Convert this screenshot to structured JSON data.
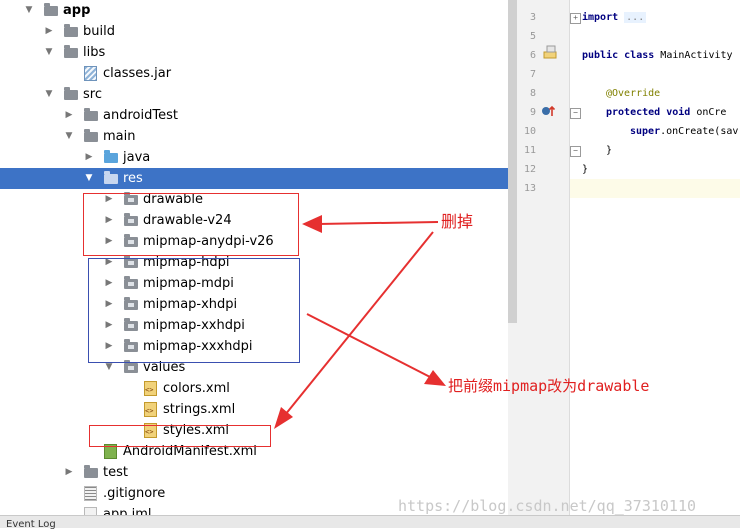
{
  "tree": {
    "rows": [
      {
        "label": "app",
        "indent": 0,
        "arrow": "down",
        "icon": "folder-icon",
        "bold": true
      },
      {
        "label": "build",
        "indent": 1,
        "arrow": "right",
        "icon": "folder-icon"
      },
      {
        "label": "libs",
        "indent": 1,
        "arrow": "down",
        "icon": "folder-icon"
      },
      {
        "label": "classes.jar",
        "indent": 2,
        "arrow": "none",
        "icon": "jar-file-icon"
      },
      {
        "label": "src",
        "indent": 1,
        "arrow": "down",
        "icon": "folder-icon"
      },
      {
        "label": "androidTest",
        "indent": 2,
        "arrow": "right",
        "icon": "folder-icon"
      },
      {
        "label": "main",
        "indent": 2,
        "arrow": "down",
        "icon": "folder-icon"
      },
      {
        "label": "java",
        "indent": 3,
        "arrow": "right",
        "icon": "source-folder-icon"
      },
      {
        "label": "res",
        "indent": 3,
        "arrow": "down",
        "icon": "resource-folder-icon",
        "selected": true
      },
      {
        "label": "drawable",
        "indent": 4,
        "arrow": "right",
        "icon": "package-folder-icon"
      },
      {
        "label": "drawable-v24",
        "indent": 4,
        "arrow": "right",
        "icon": "package-folder-icon"
      },
      {
        "label": "mipmap-anydpi-v26",
        "indent": 4,
        "arrow": "right",
        "icon": "package-folder-icon"
      },
      {
        "label": "mipmap-hdpi",
        "indent": 4,
        "arrow": "right",
        "icon": "package-folder-icon"
      },
      {
        "label": "mipmap-mdpi",
        "indent": 4,
        "arrow": "right",
        "icon": "package-folder-icon"
      },
      {
        "label": "mipmap-xhdpi",
        "indent": 4,
        "arrow": "right",
        "icon": "package-folder-icon"
      },
      {
        "label": "mipmap-xxhdpi",
        "indent": 4,
        "arrow": "right",
        "icon": "package-folder-icon"
      },
      {
        "label": "mipmap-xxxhdpi",
        "indent": 4,
        "arrow": "right",
        "icon": "package-folder-icon"
      },
      {
        "label": "values",
        "indent": 4,
        "arrow": "down",
        "icon": "package-folder-icon"
      },
      {
        "label": "colors.xml",
        "indent": 5,
        "arrow": "none",
        "icon": "xml-file-icon"
      },
      {
        "label": "strings.xml",
        "indent": 5,
        "arrow": "none",
        "icon": "xml-file-icon"
      },
      {
        "label": "styles.xml",
        "indent": 5,
        "arrow": "none",
        "icon": "xml-file-icon"
      },
      {
        "label": "AndroidManifest.xml",
        "indent": 3,
        "arrow": "none",
        "icon": "manifest-file-icon"
      },
      {
        "label": "test",
        "indent": 2,
        "arrow": "right",
        "icon": "folder-icon"
      },
      {
        "label": ".gitignore",
        "indent": 2,
        "arrow": "none",
        "icon": "text-file-icon"
      },
      {
        "label": "app.iml",
        "indent": 2,
        "arrow": "none",
        "icon": "module-file-icon"
      }
    ]
  },
  "editor": {
    "line_numbers": [
      "3",
      "5",
      "6",
      "7",
      "8",
      "9",
      "10",
      "11",
      "12",
      "13"
    ],
    "code": {
      "line3_kw": "import",
      "line3_fold": "...",
      "line6_kw1": "public",
      "line6_kw2": "class",
      "line6_name": "MainActivity",
      "line8_ann": "@Override",
      "line9_kw1": "protected",
      "line9_kw2": "void",
      "line9_name": "onCre",
      "line10_kw": "super",
      "line10_rest": ".onCreate(sav",
      "line11": "}",
      "line12": "}"
    }
  },
  "annotations": {
    "delete_note": "删掉",
    "rename_note": "把前缀mipmap改为drawable",
    "arrow_color": "#e63030"
  },
  "statusbar": {
    "event_log": "Event Log"
  },
  "watermark": "https://blog.csdn.net/qq_37310110"
}
